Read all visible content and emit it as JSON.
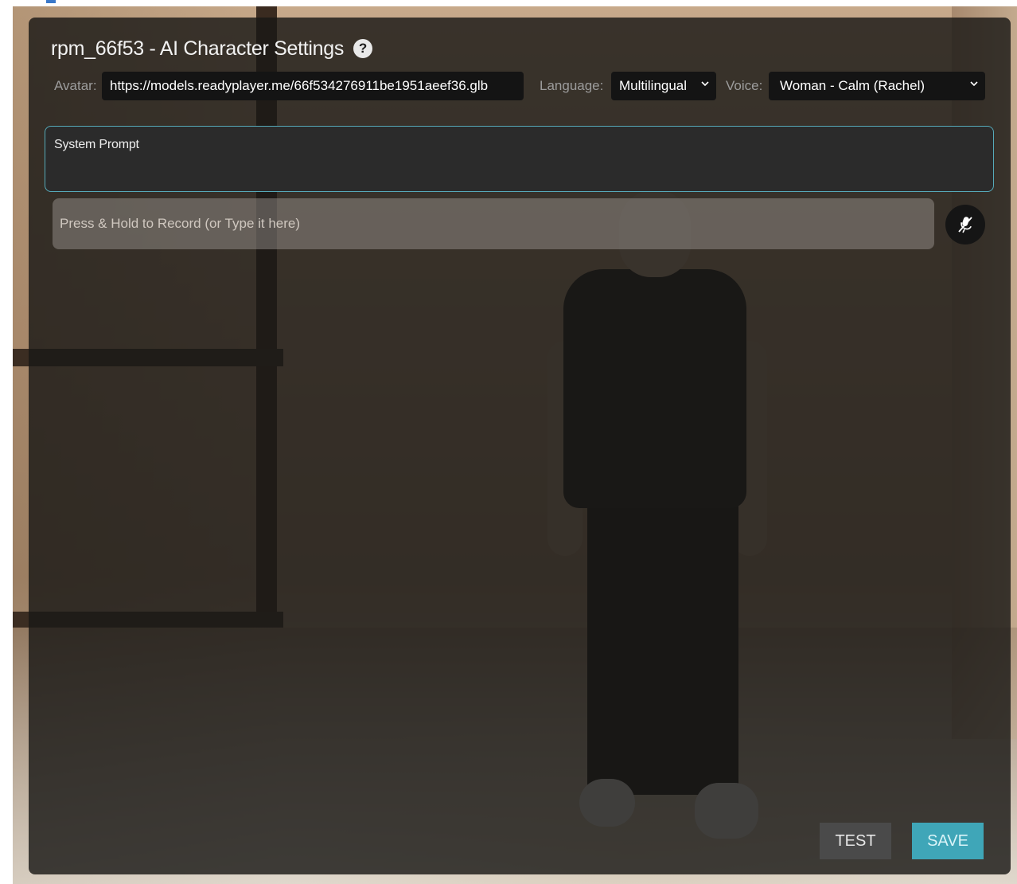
{
  "header": {
    "title": "rpm_66f53 - AI Character Settings",
    "help_icon": "question-circle-icon"
  },
  "settings": {
    "avatar_label": "Avatar:",
    "avatar_url": "https://models.readyplayer.me/66f534276911be1951aeef36.glb",
    "language_label": "Language:",
    "language_value": "Multilingual",
    "voice_label": "Voice:",
    "voice_value": "Woman - Calm (Rachel)"
  },
  "system_prompt": {
    "label": "System Prompt"
  },
  "record": {
    "placeholder": "Press & Hold to Record (or Type it here)",
    "mic_icon": "microphone-muted-icon"
  },
  "actions": {
    "test_label": "TEST",
    "save_label": "SAVE"
  },
  "colors": {
    "accent": "#3fa6b8",
    "panel_bg": "#1a1816",
    "prompt_border": "#56a9b8"
  }
}
